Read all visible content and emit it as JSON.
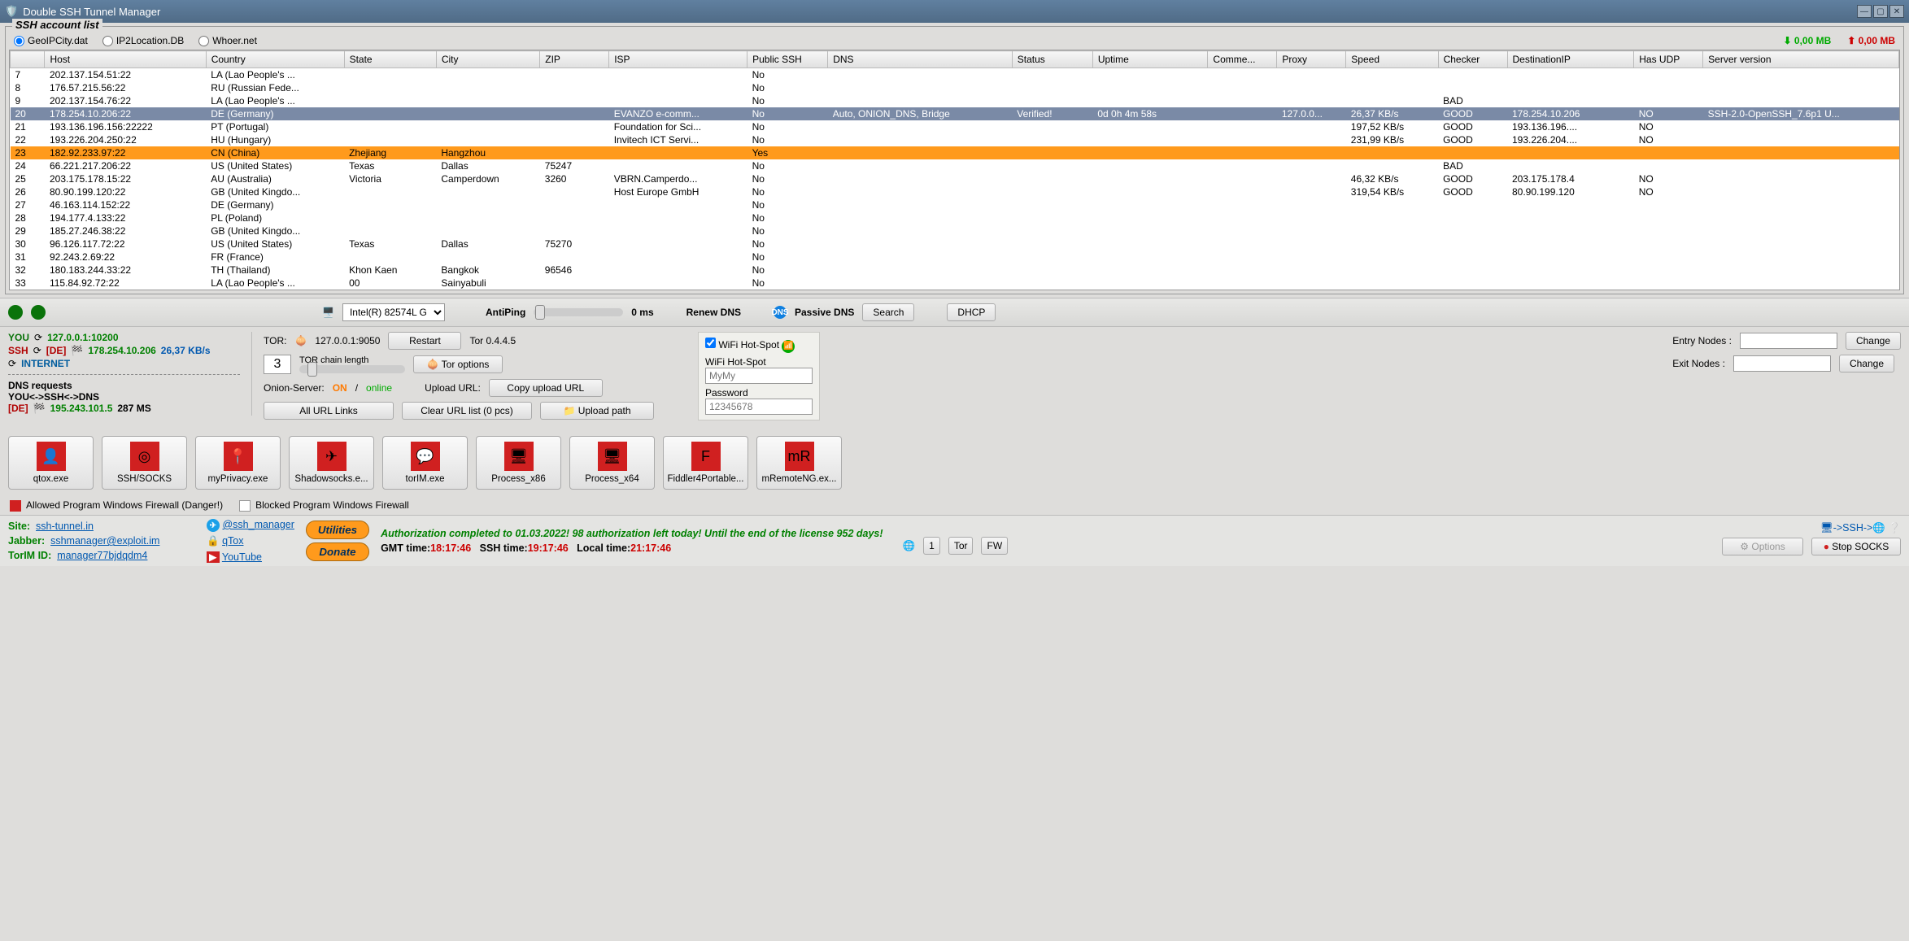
{
  "window": {
    "title": "Double SSH Tunnel Manager"
  },
  "group": {
    "title": "SSH account list"
  },
  "radios": {
    "opt1": "GeoIPCity.dat",
    "opt2": "IP2Location.DB",
    "opt3": "Whoer.net"
  },
  "traffic": {
    "down": "0,00 MB",
    "up": "0,00 MB"
  },
  "columns": [
    "Host",
    "Country",
    "State",
    "City",
    "ZIP",
    "ISP",
    "Public SSH",
    "DNS",
    "Status",
    "Uptime",
    "Comme...",
    "Proxy",
    "Speed",
    "Checker",
    "DestinationIP",
    "Has UDP",
    "Server version"
  ],
  "rows": [
    {
      "n": "7",
      "host": "202.137.154.51:22",
      "country": "LA (Lao People's ...",
      "state": "",
      "city": "",
      "zip": "",
      "isp": "",
      "pub": "No",
      "dns": "",
      "status": "",
      "uptime": "",
      "comm": "",
      "proxy": "",
      "speed": "",
      "checker": "",
      "dest": "",
      "udp": "",
      "ver": ""
    },
    {
      "n": "8",
      "host": "176.57.215.56:22",
      "country": "RU (Russian Fede...",
      "state": "",
      "city": "",
      "zip": "",
      "isp": "",
      "pub": "No",
      "dns": "",
      "status": "",
      "uptime": "",
      "comm": "",
      "proxy": "",
      "speed": "",
      "checker": "",
      "dest": "",
      "udp": "",
      "ver": ""
    },
    {
      "n": "9",
      "host": "202.137.154.76:22",
      "country": "LA (Lao People's ...",
      "state": "",
      "city": "",
      "zip": "",
      "isp": "",
      "pub": "No",
      "dns": "",
      "status": "",
      "uptime": "",
      "comm": "",
      "proxy": "",
      "speed": "",
      "checker": "BAD",
      "dest": "",
      "udp": "",
      "ver": ""
    },
    {
      "n": "20",
      "host": "178.254.10.206:22",
      "country": "DE (Germany)",
      "state": "",
      "city": "",
      "zip": "",
      "isp": "EVANZO e-comm...",
      "pub": "No",
      "dns": "Auto, ONION_DNS, Bridge",
      "status": "Verified!",
      "uptime": "0d 0h 4m 58s",
      "comm": "",
      "proxy": "127.0.0...",
      "speed": "26,37 KB/s",
      "checker": "GOOD",
      "dest": "178.254.10.206",
      "udp": "NO",
      "ver": "SSH-2.0-OpenSSH_7.6p1 U...",
      "cls": "sel"
    },
    {
      "n": "21",
      "host": "193.136.196.156:22222",
      "country": "PT (Portugal)",
      "state": "",
      "city": "",
      "zip": "",
      "isp": "Foundation for Sci...",
      "pub": "No",
      "dns": "",
      "status": "",
      "uptime": "",
      "comm": "",
      "proxy": "",
      "speed": "197,52 KB/s",
      "checker": "GOOD",
      "dest": "193.136.196....",
      "udp": "NO",
      "ver": ""
    },
    {
      "n": "22",
      "host": "193.226.204.250:22",
      "country": "HU (Hungary)",
      "state": "",
      "city": "",
      "zip": "",
      "isp": "Invitech ICT Servi...",
      "pub": "No",
      "dns": "",
      "status": "",
      "uptime": "",
      "comm": "",
      "proxy": "",
      "speed": "231,99 KB/s",
      "checker": "GOOD",
      "dest": "193.226.204....",
      "udp": "NO",
      "ver": ""
    },
    {
      "n": "23",
      "host": "182.92.233.97:22",
      "country": "CN (China)",
      "state": "Zhejiang",
      "city": "Hangzhou",
      "zip": "",
      "isp": "",
      "pub": "Yes",
      "dns": "",
      "status": "",
      "uptime": "",
      "comm": "",
      "proxy": "",
      "speed": "",
      "checker": "",
      "dest": "",
      "udp": "",
      "ver": "",
      "cls": "hl"
    },
    {
      "n": "24",
      "host": "66.221.217.206:22",
      "country": "US (United States)",
      "state": "Texas",
      "city": "Dallas",
      "zip": "75247",
      "isp": "",
      "pub": "No",
      "dns": "",
      "status": "",
      "uptime": "",
      "comm": "",
      "proxy": "",
      "speed": "",
      "checker": "BAD",
      "dest": "",
      "udp": "",
      "ver": ""
    },
    {
      "n": "25",
      "host": "203.175.178.15:22",
      "country": "AU (Australia)",
      "state": "Victoria",
      "city": "Camperdown",
      "zip": "3260",
      "isp": "VBRN.Camperdo...",
      "pub": "No",
      "dns": "",
      "status": "",
      "uptime": "",
      "comm": "",
      "proxy": "",
      "speed": "46,32 KB/s",
      "checker": "GOOD",
      "dest": "203.175.178.4",
      "udp": "NO",
      "ver": ""
    },
    {
      "n": "26",
      "host": "80.90.199.120:22",
      "country": "GB (United Kingdo...",
      "state": "",
      "city": "",
      "zip": "",
      "isp": "Host Europe GmbH",
      "pub": "No",
      "dns": "",
      "status": "",
      "uptime": "",
      "comm": "",
      "proxy": "",
      "speed": "319,54 KB/s",
      "checker": "GOOD",
      "dest": "80.90.199.120",
      "udp": "NO",
      "ver": ""
    },
    {
      "n": "27",
      "host": "46.163.114.152:22",
      "country": "DE (Germany)",
      "state": "",
      "city": "",
      "zip": "",
      "isp": "",
      "pub": "No",
      "dns": "",
      "status": "",
      "uptime": "",
      "comm": "",
      "proxy": "",
      "speed": "",
      "checker": "",
      "dest": "",
      "udp": "",
      "ver": ""
    },
    {
      "n": "28",
      "host": "194.177.4.133:22",
      "country": "PL (Poland)",
      "state": "",
      "city": "",
      "zip": "",
      "isp": "",
      "pub": "No",
      "dns": "",
      "status": "",
      "uptime": "",
      "comm": "",
      "proxy": "",
      "speed": "",
      "checker": "",
      "dest": "",
      "udp": "",
      "ver": ""
    },
    {
      "n": "29",
      "host": "185.27.246.38:22",
      "country": "GB (United Kingdo...",
      "state": "",
      "city": "",
      "zip": "",
      "isp": "",
      "pub": "No",
      "dns": "",
      "status": "",
      "uptime": "",
      "comm": "",
      "proxy": "",
      "speed": "",
      "checker": "",
      "dest": "",
      "udp": "",
      "ver": ""
    },
    {
      "n": "30",
      "host": "96.126.117.72:22",
      "country": "US (United States)",
      "state": "Texas",
      "city": "Dallas",
      "zip": "75270",
      "isp": "",
      "pub": "No",
      "dns": "",
      "status": "",
      "uptime": "",
      "comm": "",
      "proxy": "",
      "speed": "",
      "checker": "",
      "dest": "",
      "udp": "",
      "ver": ""
    },
    {
      "n": "31",
      "host": "92.243.2.69:22",
      "country": "FR (France)",
      "state": "",
      "city": "",
      "zip": "",
      "isp": "",
      "pub": "No",
      "dns": "",
      "status": "",
      "uptime": "",
      "comm": "",
      "proxy": "",
      "speed": "",
      "checker": "",
      "dest": "",
      "udp": "",
      "ver": ""
    },
    {
      "n": "32",
      "host": "180.183.244.33:22",
      "country": "TH (Thailand)",
      "state": "Khon Kaen",
      "city": "Bangkok",
      "zip": "96546",
      "isp": "",
      "pub": "No",
      "dns": "",
      "status": "",
      "uptime": "",
      "comm": "",
      "proxy": "",
      "speed": "",
      "checker": "",
      "dest": "",
      "udp": "",
      "ver": ""
    },
    {
      "n": "33",
      "host": "115.84.92.72:22",
      "country": "LA (Lao People's ...",
      "state": "00",
      "city": "Sainyabuli",
      "zip": "",
      "isp": "",
      "pub": "No",
      "dns": "",
      "status": "",
      "uptime": "",
      "comm": "",
      "proxy": "",
      "speed": "",
      "checker": "",
      "dest": "",
      "udp": "",
      "ver": ""
    }
  ],
  "midbar": {
    "adapter": "Intel(R) 82574L G",
    "antiping_label": "AntiPing",
    "antiping_value": "0 ms",
    "renew_label": "Renew DNS",
    "passive_label": "Passive DNS",
    "search_btn": "Search",
    "dhcp_btn": "DHCP"
  },
  "route": {
    "you_lbl": "YOU",
    "you_ip": "127.0.0.1:10200",
    "ssh_lbl": "SSH",
    "ssh_tag": "[DE]",
    "ssh_ip": "178.254.10.206",
    "ssh_rate": "26,37 KB/s",
    "net_lbl": "INTERNET",
    "dns_title": "DNS requests",
    "chain": "YOU<->SSH<->DNS",
    "dns_tag": "[DE]",
    "dns_ip": "195.243.101.5",
    "dns_ms": "287 MS"
  },
  "tor": {
    "label": "TOR:",
    "addr": "127.0.0.1:9050",
    "restart": "Restart",
    "ver": "Tor 0.4.4.5",
    "chain_lbl": "TOR chain length",
    "chain_val": "3",
    "options": "Tor options",
    "onion_lbl": "Onion-Server:",
    "onion_on": "ON",
    "onion_online": "online",
    "upload_lbl": "Upload URL:",
    "copy": "Copy upload URL",
    "all_url": "All URL Links",
    "clear": "Clear URL list (0 pcs)",
    "upload_path": "Upload path"
  },
  "wifi": {
    "check_lbl": "WiFi Hot-Spot",
    "name_lbl": "WiFi Hot-Spot",
    "name_ph": "MyMy",
    "pass_lbl": "Password",
    "pass_ph": "12345678"
  },
  "nodes": {
    "entry_lbl": "Entry Nodes :",
    "exit_lbl": "Exit Nodes :",
    "change": "Change"
  },
  "launchers": [
    {
      "label": "qtox.exe",
      "glyph": "👤"
    },
    {
      "label": "SSH/SOCKS",
      "glyph": "◎"
    },
    {
      "label": "myPrivacy.exe",
      "glyph": "📍"
    },
    {
      "label": "Shadowsocks.e...",
      "glyph": "✈"
    },
    {
      "label": "torIM.exe",
      "glyph": "💬"
    },
    {
      "label": "Process_x86",
      "glyph": "🖥"
    },
    {
      "label": "Process_x64",
      "glyph": "🖥"
    },
    {
      "label": "Fiddler4Portable...",
      "glyph": "F"
    },
    {
      "label": "mRemoteNG.ex...",
      "glyph": "mR"
    }
  ],
  "firewall": {
    "allowed": "Allowed Program Windows Firewall (Danger!)",
    "blocked": "Blocked Program Windows Firewall"
  },
  "footer": {
    "site_lbl": "Site:",
    "site": "ssh-tunnel.in",
    "jabber_lbl": "Jabber:",
    "jabber": "sshmanager@exploit.im",
    "torim_lbl": "TorIM ID:",
    "torim": "manager77bjdqdm4",
    "tg": "@ssh_manager",
    "qtox": "qTox",
    "yt": "YouTube",
    "util": "Utilities",
    "donate": "Donate",
    "auth": "Authorization completed to 01.03.2022! 98 authorization left today! Until the end of the license 952 days!",
    "gmt_lbl": "GMT time:",
    "gmt": "18:17:46",
    "ssh_lbl": "SSH time:",
    "ssh": "19:17:46",
    "loc_lbl": "Local time:",
    "loc": "21:17:46",
    "one": "1",
    "tor": "Tor",
    "fw": "FW",
    "sshchain": "->SSH->",
    "options": "Options",
    "stop": "Stop SOCKS"
  }
}
